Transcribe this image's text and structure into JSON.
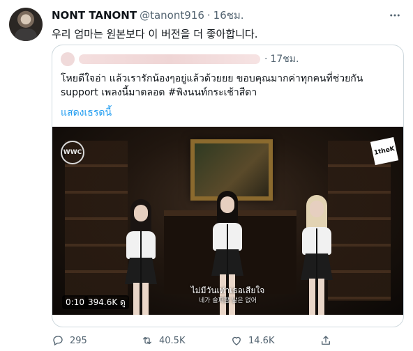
{
  "tweet": {
    "name": "NONT TANONT",
    "handle": "@tanont916",
    "dot": "·",
    "time": "16ชม.",
    "more_icon": "ellipsis-icon",
    "text": "우리 엄마는 원본보다 이 버전을 더 좋아합니다."
  },
  "quote": {
    "dot": "·",
    "time": "17ชม.",
    "line1": "โหยดีใจอ่า แล้วเรารักน้องๆอยู่แล้วด้วยยย ขอบคุณมากค่าทุกคนที่ช่วยกัน",
    "line2": "support เพลงนี้มาตลอด #พิงนนท์กระเช้าสีดา",
    "show_thread": "แสดงเธรดนี้",
    "video": {
      "logo_left": "WWC",
      "logo_right": "1theK",
      "subtitle_th": "ไม่มีวันเท่าเธอเสียใจ",
      "subtitle_ko": "네가 슬퍼할 날은 없어",
      "duration": "0:10",
      "views": "394.6K ดู"
    }
  },
  "actions": {
    "reply_count": "295",
    "retweet_count": "40.5K",
    "like_count": "14.6K"
  },
  "colors": {
    "text_primary": "#0f1419",
    "text_secondary": "#536471",
    "link": "#1d9bf0",
    "border": "#cfd9de"
  }
}
